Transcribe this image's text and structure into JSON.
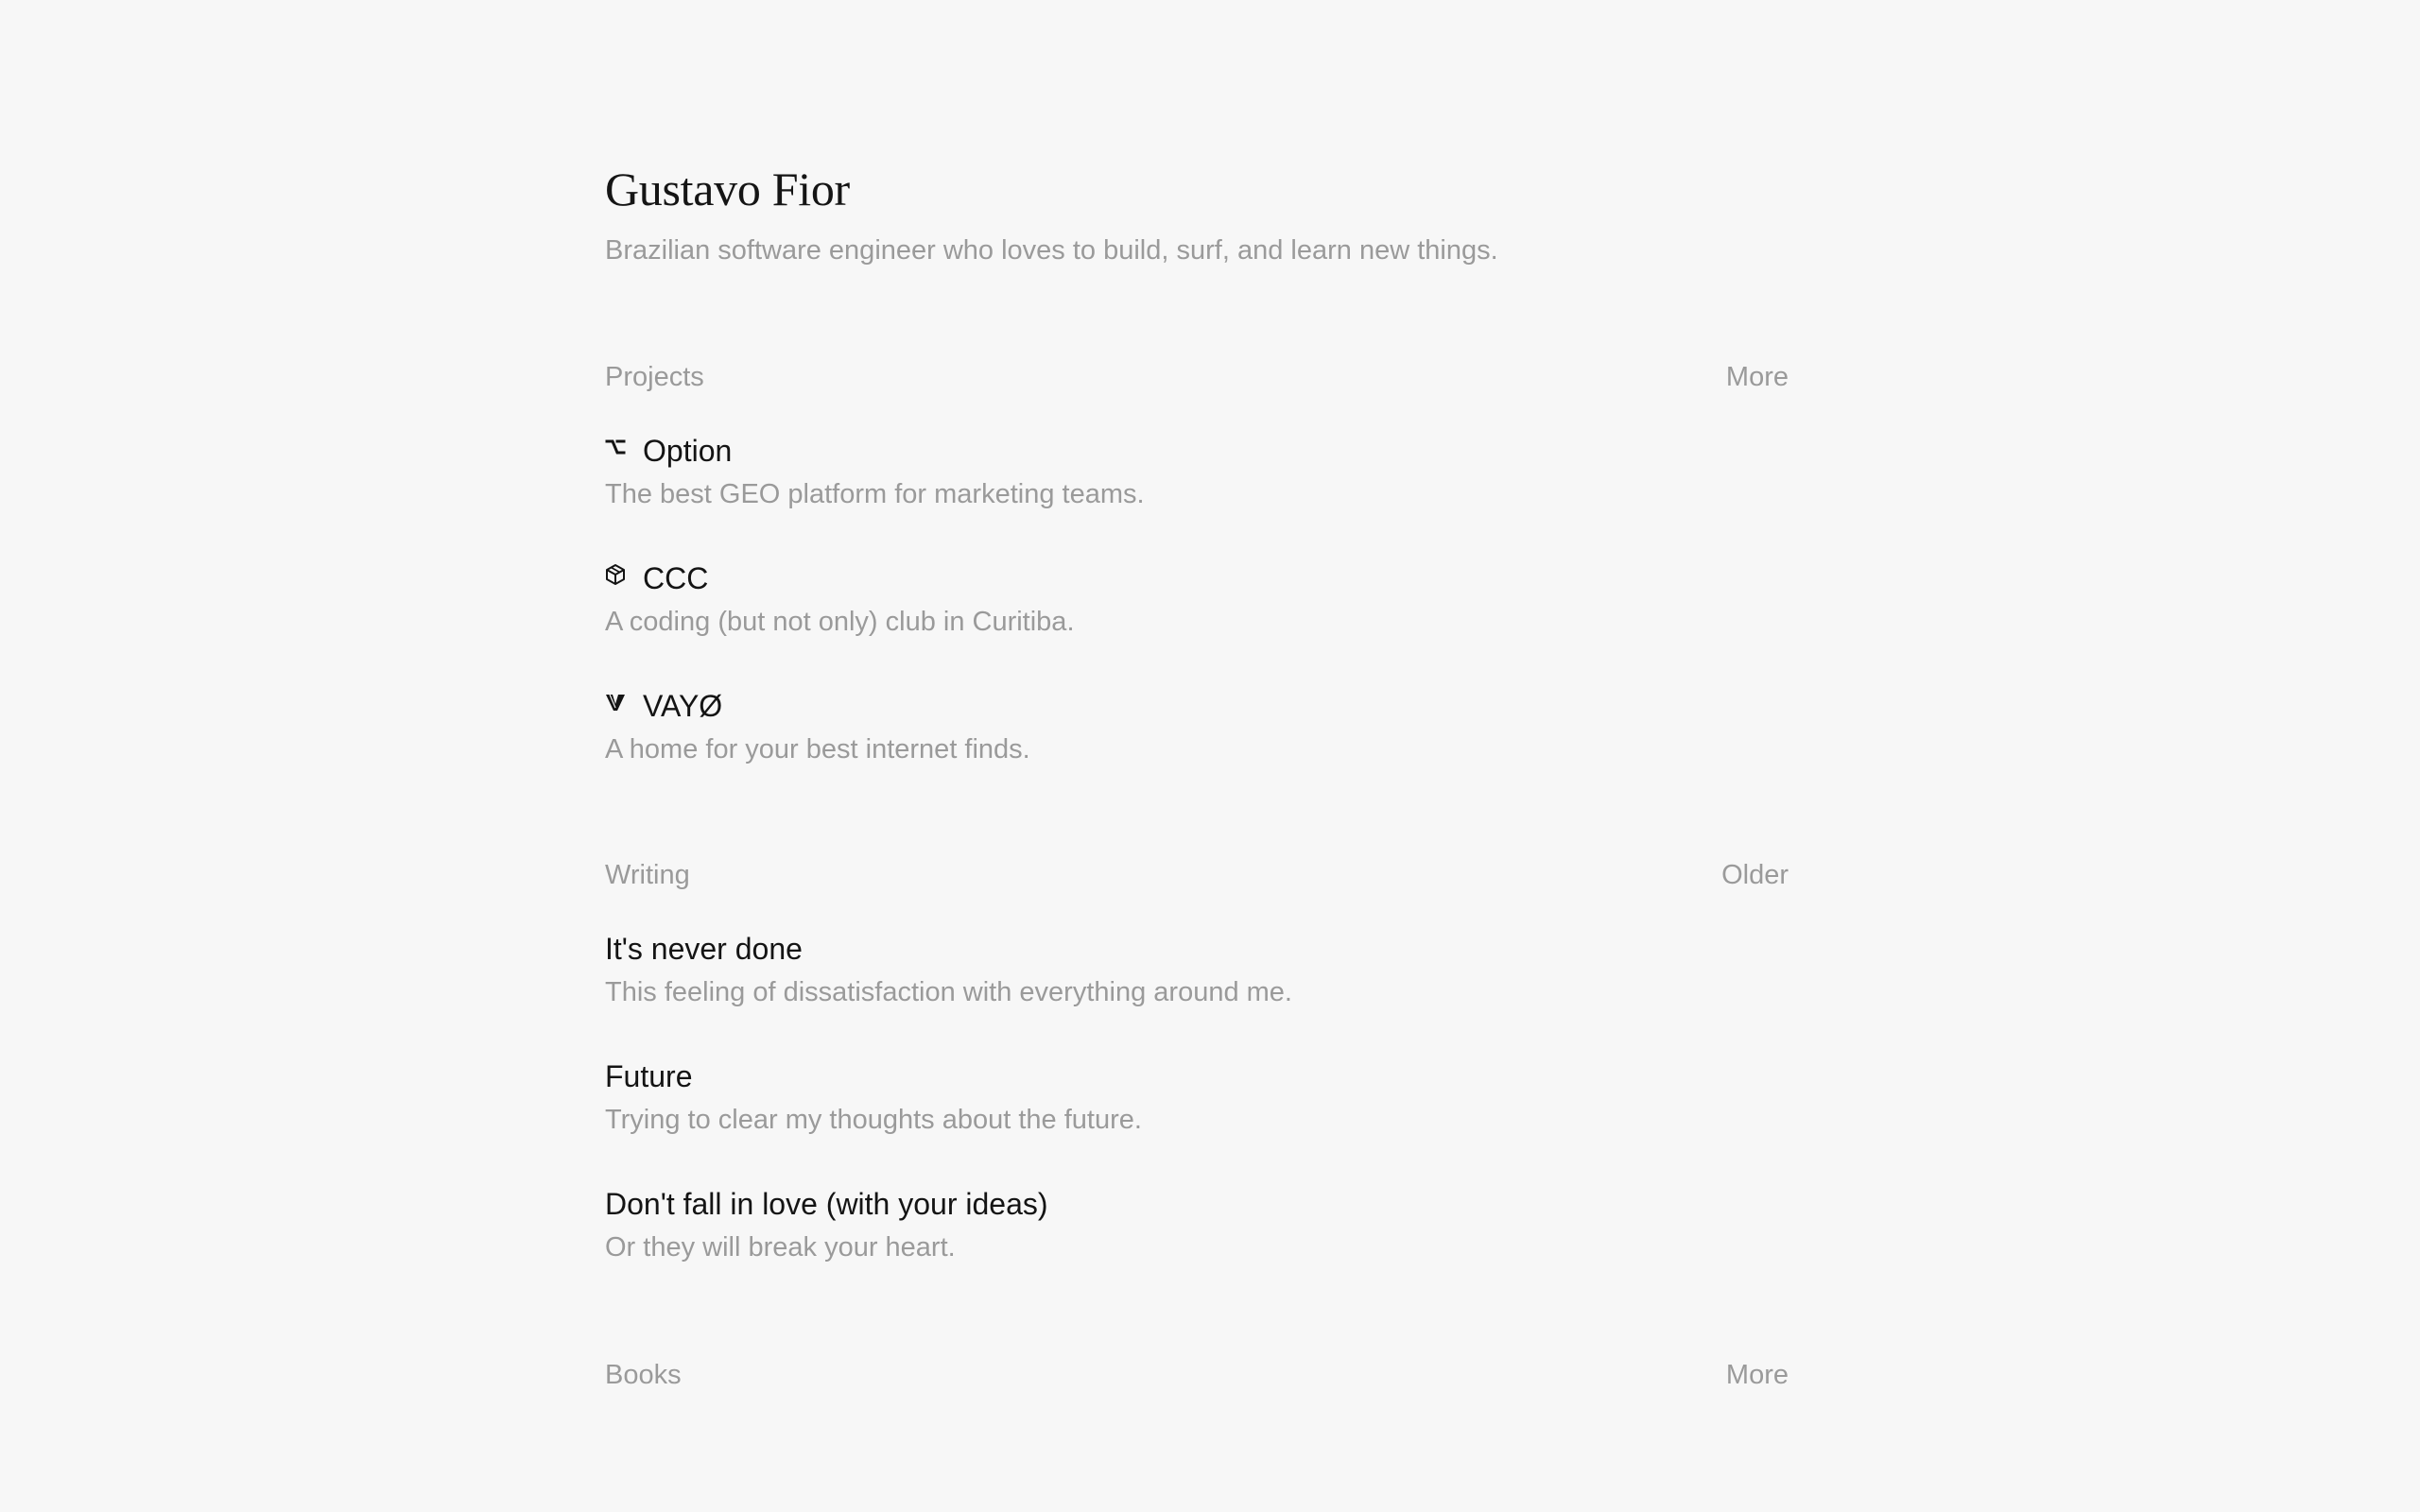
{
  "profile": {
    "name": "Gustavo Fior",
    "bio": "Brazilian software engineer who loves to build, surf, and learn new things."
  },
  "projects": {
    "heading": "Projects",
    "more_label": "More",
    "items": [
      {
        "title": "Option",
        "description": "The best GEO platform for marketing teams.",
        "icon": "option-key-icon"
      },
      {
        "title": "CCC",
        "description": "A coding (but not only) club in Curitiba.",
        "icon": "cube-icon"
      },
      {
        "title": "VAYØ",
        "description": "A home for your best internet finds.",
        "icon": "v-logo-icon"
      }
    ]
  },
  "writing": {
    "heading": "Writing",
    "older_label": "Older",
    "items": [
      {
        "title": "It's never done",
        "description": "This feeling of dissatisfaction with everything around me."
      },
      {
        "title": "Future",
        "description": "Trying to clear my thoughts about the future."
      },
      {
        "title": "Don't fall in love (with your ideas)",
        "description": "Or they will break your heart."
      }
    ]
  },
  "books": {
    "heading": "Books",
    "more_label": "More"
  },
  "colors": {
    "background": "#f7f7f7",
    "text_primary": "#141414",
    "text_secondary": "#9a9a9a"
  }
}
